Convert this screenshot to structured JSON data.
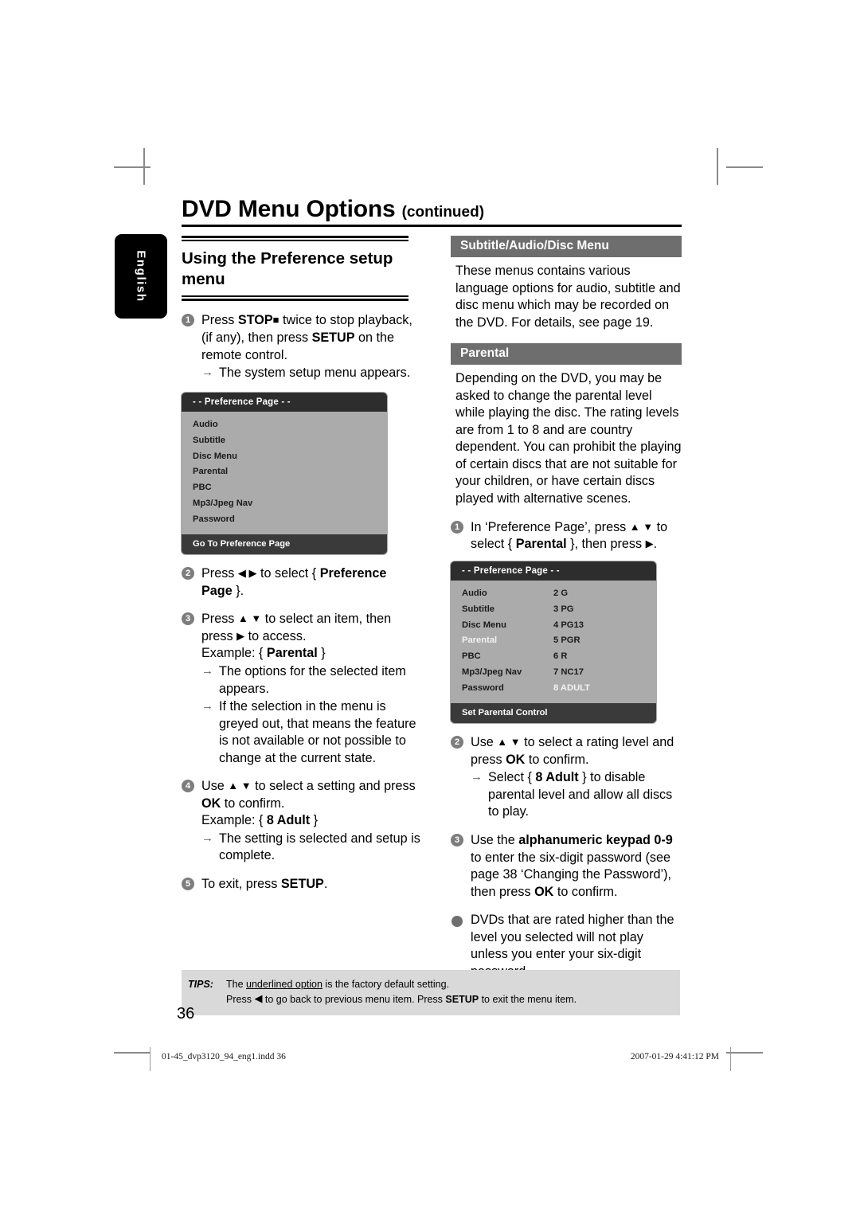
{
  "document": {
    "page_title": "DVD Menu Options",
    "page_title_suffix": "(continued)",
    "side_tab": "English",
    "page_number": "36"
  },
  "left_column": {
    "heading": "Using the Preference setup menu",
    "step1": {
      "num": "1",
      "line1_a": "Press ",
      "line1_stop": "STOP",
      "line1_square": "■",
      "line1_b": " twice to stop playback, (if any), then press ",
      "line1_setup": "SETUP",
      "line1_c": " on the remote control.",
      "arrow_note": "The system setup menu appears."
    },
    "osd1": {
      "header": "- -  Preference Page   - -",
      "items": [
        {
          "label": "Audio",
          "value": ""
        },
        {
          "label": "Subtitle",
          "value": ""
        },
        {
          "label": "Disc Menu",
          "value": ""
        },
        {
          "label": "Parental",
          "value": ""
        },
        {
          "label": "PBC",
          "value": ""
        },
        {
          "label": "Mp3/Jpeg Nav",
          "value": ""
        },
        {
          "label": "Password",
          "value": ""
        }
      ],
      "footer": "Go To Preference Page"
    },
    "step2": {
      "num": "2",
      "a": "Press ",
      "arrows": "◀ ▶",
      "b": " to select { ",
      "bold": "Preference Page",
      "c": " }."
    },
    "step3": {
      "num": "3",
      "a": "Press ",
      "arrows": "▲ ▼",
      "b": " to select an item, then press ",
      "arrow_right": "▶",
      "c": " to access.",
      "example_label": "Example: { ",
      "example_bold": "Parental",
      "example_close": " }",
      "note1": "The options for the selected item appears.",
      "note2": "If the selection in the menu is greyed out, that means the feature is not available or not possible to change at the current state."
    },
    "step4": {
      "num": "4",
      "a": "Use ",
      "arrows": "▲ ▼",
      "b": " to select a setting and press ",
      "ok": "OK",
      "c": " to confirm.",
      "example_label": "Example: { ",
      "example_bold": "8 Adult",
      "example_close": " }",
      "note1": "The setting is selected and setup is complete."
    },
    "step5": {
      "num": "5",
      "a": "To exit, press ",
      "setup": "SETUP",
      "b": "."
    }
  },
  "right_column": {
    "section1": {
      "bar_title": "Subtitle/Audio/Disc Menu",
      "paragraph": "These menus contains various language options for audio, subtitle and disc menu which may be recorded on the DVD. For details, see page 19."
    },
    "section2": {
      "bar_title": "Parental",
      "paragraph": "Depending on the DVD, you may be asked to change the parental level while playing the disc. The rating levels are from 1 to 8 and are country dependent. You can prohibit the playing of certain discs that are not suitable for your children, or have certain discs played with alternative scenes.",
      "step1": {
        "num": "1",
        "a": "In ‘Preference Page’, press ",
        "arrows": "▲ ▼",
        "b": " to select { ",
        "bold": "Parental",
        "c": " }, then press ",
        "arrow_right": "▶",
        "d": "."
      },
      "osd2": {
        "header": "- -  Preference Page   - -",
        "items": [
          {
            "label": "Audio",
            "value": "2 G",
            "selected": false,
            "value_highlighted": false
          },
          {
            "label": "Subtitle",
            "value": "3 PG",
            "selected": false,
            "value_highlighted": false
          },
          {
            "label": "Disc Menu",
            "value": "4 PG13",
            "selected": false,
            "value_highlighted": false
          },
          {
            "label": "Parental",
            "value": "5 PGR",
            "selected": true,
            "value_highlighted": false
          },
          {
            "label": "PBC",
            "value": "6 R",
            "selected": false,
            "value_highlighted": false
          },
          {
            "label": "Mp3/Jpeg Nav",
            "value": "7 NC17",
            "selected": false,
            "value_highlighted": false
          },
          {
            "label": "Password",
            "value": "8 ADULT",
            "selected": false,
            "value_highlighted": true
          }
        ],
        "footer": "Set Parental Control"
      },
      "step2": {
        "num": "2",
        "a": "Use ",
        "arrows": "▲ ▼",
        "b": " to select a rating level and press ",
        "ok": "OK",
        "c": " to confirm.",
        "note_a": "Select { ",
        "note_bold": "8 Adult",
        "note_b": " } to disable parental level and allow all discs to play."
      },
      "step3": {
        "num": "3",
        "a": "Use the ",
        "bold1": "alphanumeric keypad 0-9",
        "b": " to enter the six-digit password (see page 38 ‘Changing the Password’), then press ",
        "ok": "OK",
        "c": " to confirm."
      },
      "bullet": {
        "text": "DVDs that are rated higher than the level you selected will not play unless you enter your six-digit password."
      }
    }
  },
  "tips": {
    "label": "TIPS:",
    "line1_a": "The ",
    "line1_underline": "underlined option",
    "line1_b": " is the factory default setting.",
    "line2_a": "Press ",
    "line2_arrow": "◀",
    "line2_b": " to go back to previous menu item. Press ",
    "line2_setup": "SETUP",
    "line2_c": " to exit the menu item."
  },
  "print_footer": {
    "file": "01-45_dvp3120_94_eng1.indd   36",
    "timestamp": "2007-01-29   4:41:12 PM"
  },
  "colors": {
    "section_bar": "#6e6e6e",
    "osd_body": "#ababab",
    "osd_header": "#2d2d2d",
    "osd_footer": "#3a3a3a",
    "tips_bg": "#d9d9d9",
    "step_bullet": "#7d7d7d"
  }
}
